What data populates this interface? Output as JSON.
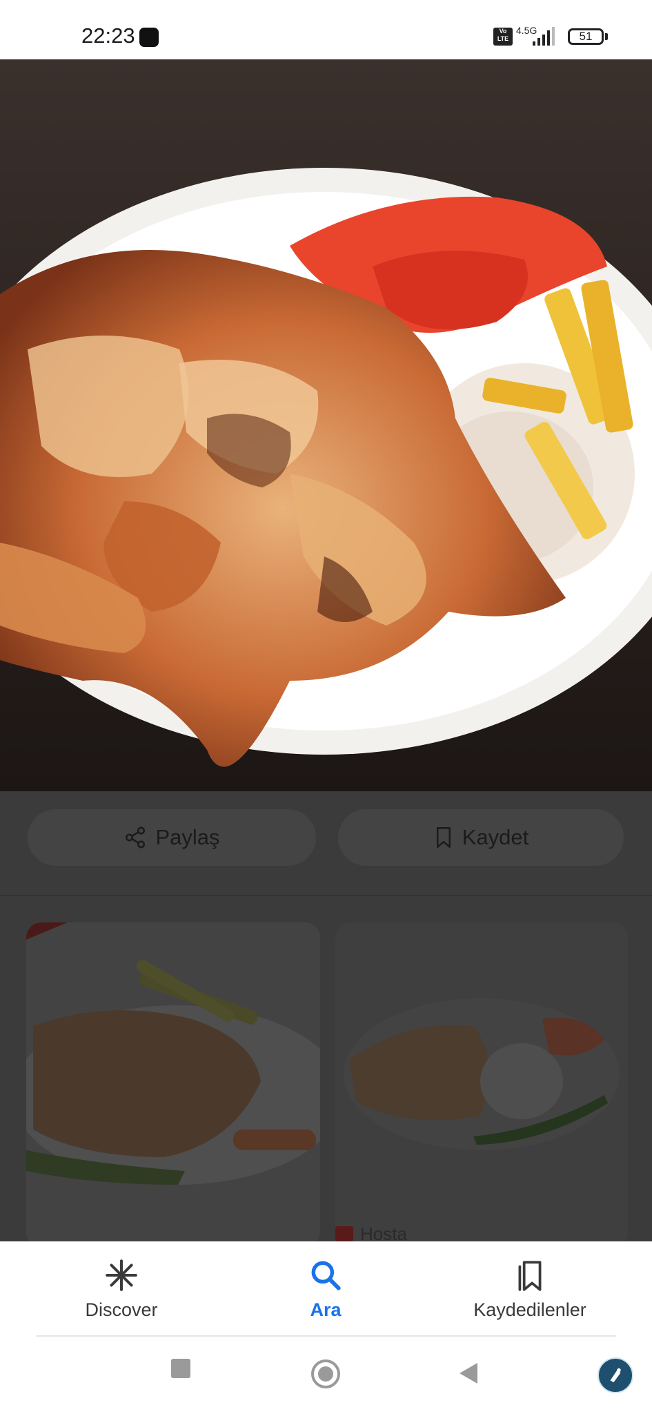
{
  "status_bar": {
    "time": "22:23",
    "network": "4.5G",
    "volte": "Vo LTE",
    "battery": "51"
  },
  "hero_image": {
    "icon": "food-photo-doner-plate"
  },
  "actions": {
    "share_label": "Paylaş",
    "share_icon": "share-icon",
    "save_label": "Kaydet",
    "save_icon": "bookmark-icon"
  },
  "related": {
    "cards": [
      {
        "icon": "food-photo-doner-fries"
      },
      {
        "icon": "food-photo-doner-rice",
        "source": "Hosta"
      }
    ]
  },
  "bottom_nav": {
    "items": [
      {
        "label": "Discover",
        "icon": "asterisk-icon",
        "active": false
      },
      {
        "label": "Ara",
        "icon": "search-icon",
        "active": true
      },
      {
        "label": "Kaydedilenler",
        "icon": "bookmarks-icon",
        "active": false
      }
    ]
  },
  "colors": {
    "accent": "#1a73e8",
    "overlay": "#3b3b3b"
  }
}
